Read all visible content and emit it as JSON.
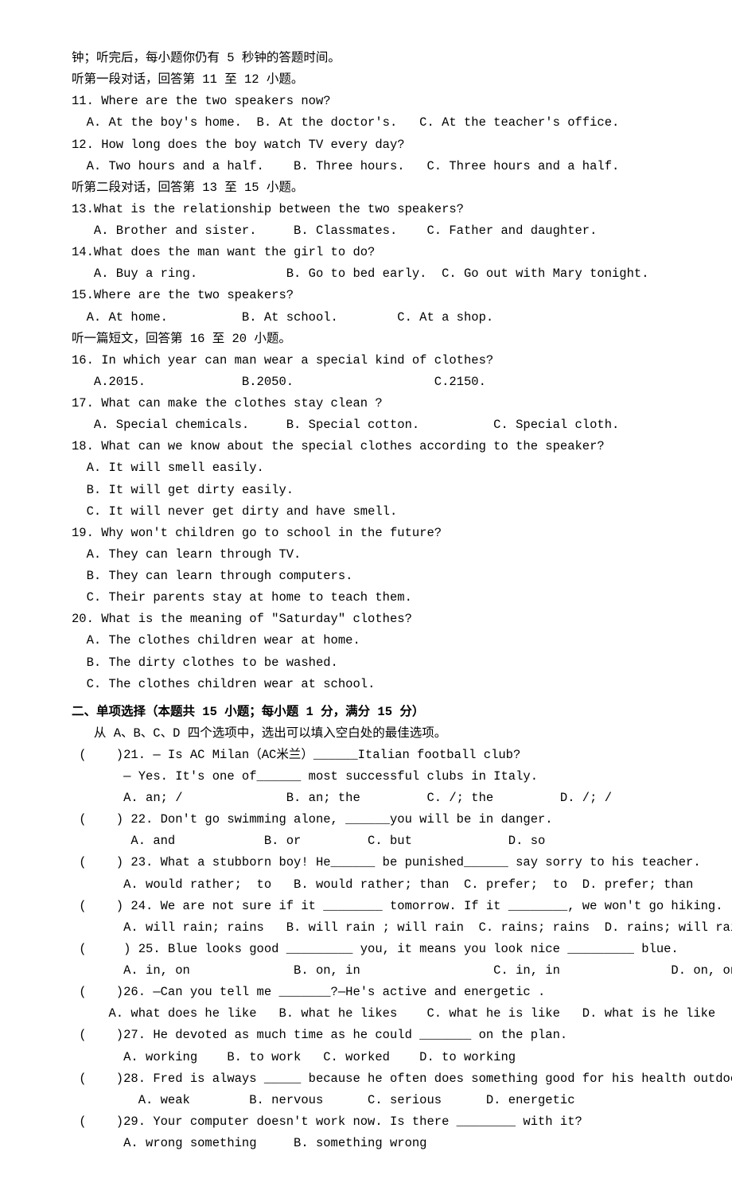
{
  "intro": [
    "钟；听完后，每小题你仍有 5 秒钟的答题时间。",
    "听第一段对话，回答第 11 至 12 小题。"
  ],
  "listening": [
    {
      "q": "11. Where are the two speakers now?",
      "opts": "  A. At the boy's home.  B. At the doctor's.   C. At the teacher's office."
    },
    {
      "q": "12. How long does the boy watch TV every day?",
      "opts": "  A. Two hours and a half.    B. Three hours.   C. Three hours and a half."
    }
  ],
  "dialog2_header": "听第二段对话，回答第 13 至 15 小题。",
  "listening2": [
    {
      "q": "13.What is the relationship between the two speakers?",
      "opts": "   A. Brother and sister.     B. Classmates.    C. Father and daughter."
    },
    {
      "q": "14.What does the man want the girl to do?",
      "opts": "   A. Buy a ring.            B. Go to bed early.  C. Go out with Mary tonight."
    },
    {
      "q": "15.Where are the two speakers?",
      "opts": "  A. At home.          B. At school.        C. At a shop."
    }
  ],
  "passage_header": "听一篇短文，回答第 16 至 20 小题。",
  "listening3": [
    {
      "q": "16. In which year can man wear a special kind of clothes?",
      "opts": "   A.2015.             B.2050.                   C.2150."
    },
    {
      "q": "17. What can make the clothes stay clean ?",
      "opts": "   A. Special chemicals.     B. Special cotton.          C. Special cloth."
    },
    {
      "q": "18. What can we know about the special clothes according to the speaker?",
      "opts_multi": [
        "  A. It will smell easily.",
        "  B. It will get dirty easily.",
        "  C. It will never get dirty and have smell."
      ]
    },
    {
      "q": "19. Why won't children go to school in the future?",
      "opts_multi": [
        "  A. They can learn through TV.",
        "  B. They can learn through computers.",
        "  C. Their parents stay at home to teach them."
      ]
    },
    {
      "q": "20. What is the meaning of \"Saturday\" clothes?",
      "opts_multi": [
        "  A. The clothes children wear at home.",
        "  B. The dirty clothes to be washed.",
        "  C. The clothes children wear at school."
      ]
    }
  ],
  "section2": {
    "title": "二、单项选择（本题共 15 小题；每小题 1 分，满分 15 分）",
    "instruction": "   从 A、B、C、D 四个选项中，选出可以填入空白处的最佳选项。"
  },
  "mcq": [
    {
      "q": " (    )21. — Is AC Milan（AC米兰）______Italian football club?",
      "extra": "       — Yes. It's one of______ most successful clubs in Italy.",
      "opts": "       A. an; /              B. an; the         C. /; the         D. /; /"
    },
    {
      "q": " (    ) 22. Don't go swimming alone, ______you will be in danger.",
      "opts": "        A. and            B. or         C. but             D. so"
    },
    {
      "q": " (    ) 23. What a stubborn boy! He______ be punished______ say sorry to his teacher.",
      "opts": "       A. would rather;  to   B. would rather; than  C. prefer;  to  D. prefer; than"
    },
    {
      "q": " (    ) 24. We are not sure if it ________ tomorrow. If it ________, we won't go hiking.",
      "opts": "       A. will rain; rains   B. will rain ; will rain  C. rains; rains  D. rains; will rain"
    },
    {
      "q": " (     ) 25. Blue looks good _________ you, it means you look nice _________ blue.",
      "opts": "       A. in, on              B. on, in                  C. in, in               D. on, on"
    },
    {
      "q": " (    )26. —Can you tell me _______?—He's active and energetic .",
      "opts": "     A. what does he like   B. what he likes    C. what he is like   D. what is he like"
    },
    {
      "q": " (    )27. He devoted as much time as he could _______ on the plan.",
      "opts": "       A. working    B. to work   C. worked    D. to working"
    },
    {
      "q": " (    )28. Fred is always _____ because he often does something good for his health outdoors.",
      "opts": "         A. weak        B. nervous      C. serious      D. energetic"
    },
    {
      "q": " (    )29. Your computer doesn't work now. Is there ________ with it?",
      "opts": "       A. wrong something     B. something wrong"
    }
  ]
}
